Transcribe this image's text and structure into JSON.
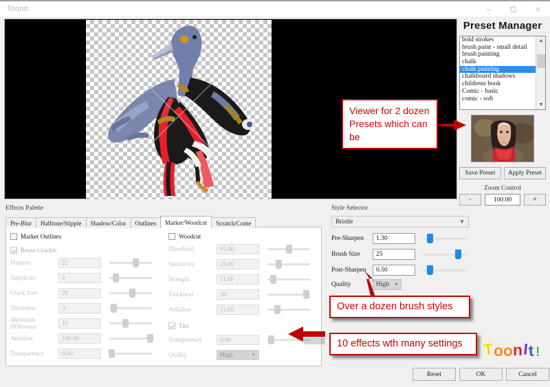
{
  "window": {
    "title": "ToonIt",
    "controls": [
      {
        "name": "minimize-button",
        "glyph": "minimize"
      },
      {
        "name": "maximize-button",
        "glyph": "maximize"
      },
      {
        "name": "close-button",
        "glyph": "close"
      }
    ]
  },
  "preview": {
    "name": "image-preview-canvas",
    "background_color": "#000000",
    "subject": "cartoonized bird on transparency checkerboard"
  },
  "preset_manager": {
    "title": "Preset Manager",
    "items": [
      {
        "label": "bold strokes",
        "selected": false
      },
      {
        "label": "brush paint - small detail",
        "selected": false
      },
      {
        "label": "brush painting",
        "selected": false
      },
      {
        "label": "chalk",
        "selected": false
      },
      {
        "label": "chalk painting",
        "selected": true
      },
      {
        "label": "chalkboard shadows",
        "selected": false
      },
      {
        "label": "childrens book",
        "selected": false
      },
      {
        "label": "Comic - basic",
        "selected": false
      },
      {
        "label": "comic - soft",
        "selected": false
      }
    ],
    "save_label": "Save Preset",
    "apply_label": "Apply Preset",
    "zoom_label": "Zoom Control",
    "zoom_minus": "-",
    "zoom_value": "100.00",
    "zoom_plus": "+",
    "selection_color": "#2a8fee"
  },
  "effects_palette": {
    "label": "Effects Palette",
    "tabs": [
      {
        "label": "Pre-Blur",
        "active": false
      },
      {
        "label": "Halftone/Stipple",
        "active": false
      },
      {
        "label": "Shadow/Color",
        "active": false
      },
      {
        "label": "Outlines",
        "active": false
      },
      {
        "label": "Marker/Woodcut",
        "active": true
      },
      {
        "label": "Scratch/Conte",
        "active": false
      }
    ],
    "left_column": {
      "marker_outlines": {
        "label": "Marker Outlines",
        "checked": false
      },
      "reuse_crackle": {
        "label": "Reuse Crackle",
        "checked": true
      },
      "rows": [
        {
          "label": "Flatness",
          "value": "22",
          "slider": 62
        },
        {
          "label": "Simplicity",
          "value": "5",
          "slider": 14
        },
        {
          "label": "Crack Size",
          "value": "20",
          "slider": 53
        },
        {
          "label": "Thickness",
          "value": "3",
          "slider": 10
        },
        {
          "label": "Minimum Difference",
          "value": "10",
          "slider": 37
        },
        {
          "label": "Antialias",
          "value": "100.00",
          "slider": 95
        },
        {
          "label": "Transparency",
          "value": "0.00",
          "slider": 5
        }
      ]
    },
    "right_column": {
      "woodcut": {
        "label": "Woodcut",
        "checked": false
      },
      "tint": {
        "label": "Tint",
        "checked": true
      },
      "rows": [
        {
          "label": "Threshold",
          "value": "65.00",
          "slider": 50
        },
        {
          "label": "Sensitivity",
          "value": "25.00",
          "slider": 25
        },
        {
          "label": "Strength",
          "value": "11.00",
          "slider": 13
        },
        {
          "label": "Thickness",
          "value": "30",
          "slider": 90
        },
        {
          "label": "Antialias",
          "value": "11.00",
          "slider": 22
        }
      ],
      "transparency": {
        "label": "Transparency",
        "value": "0.00",
        "slider": 8
      },
      "quality": {
        "label": "Quality",
        "value": "High"
      }
    }
  },
  "style_selector": {
    "label": "Style Selector",
    "style_value": "Bristle",
    "rows": [
      {
        "label": "Pre-Sharpen",
        "value": "1.30",
        "slider": 15
      },
      {
        "label": "Brush Size",
        "value": "25",
        "slider": 80
      },
      {
        "label": "Post-Sharpen",
        "value": "0.50",
        "slider": 15
      }
    ],
    "quality": {
      "label": "Quality",
      "value": "High"
    },
    "accent_color": "#1f87e8"
  },
  "callouts": [
    {
      "name": "callout-preset-viewer",
      "text": "Viewer for 2 dozen Presets which can be"
    },
    {
      "name": "callout-brush-styles",
      "text": "Over a dozen brush styles"
    },
    {
      "name": "callout-effects",
      "text": "10 effects wth many settings"
    }
  ],
  "logo": {
    "text": "ToonIt!",
    "letters": [
      {
        "ch": "T",
        "color": "#f5d800"
      },
      {
        "ch": "o",
        "color": "#f08a1c"
      },
      {
        "ch": "o",
        "color": "#f08a1c"
      },
      {
        "ch": "n",
        "color": "#e02020"
      },
      {
        "ch": "I",
        "color": "#7b36c4"
      },
      {
        "ch": "t",
        "color": "#2a5fd0"
      },
      {
        "ch": "!",
        "color": "#39b54a"
      }
    ]
  },
  "footer": {
    "buttons": [
      {
        "label": "Reset",
        "name": "reset-button"
      },
      {
        "label": "OK",
        "name": "ok-button"
      },
      {
        "label": "Cancel",
        "name": "cancel-button"
      }
    ]
  }
}
